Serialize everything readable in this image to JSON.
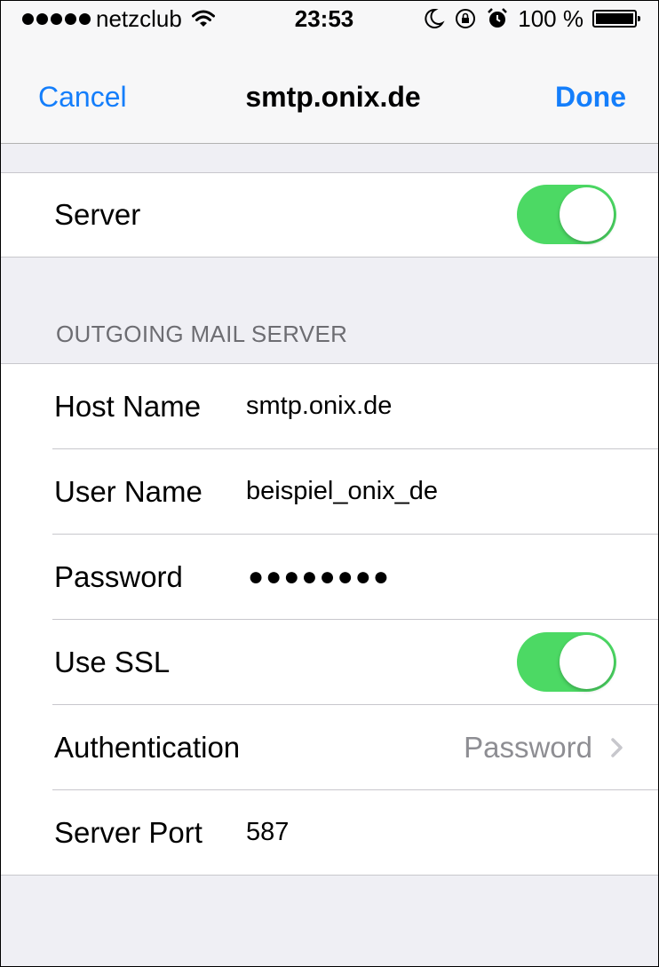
{
  "status_bar": {
    "carrier": "netzclub",
    "time": "23:53",
    "battery": "100 %"
  },
  "nav": {
    "cancel_label": "Cancel",
    "title": "smtp.onix.de",
    "done_label": "Done"
  },
  "server_group": {
    "label": "Server",
    "enabled": true
  },
  "outgoing": {
    "header": "OUTGOING MAIL SERVER",
    "host_name_label": "Host Name",
    "host_name_value": "smtp.onix.de",
    "user_name_label": "User Name",
    "user_name_value": "beispiel_onix_de",
    "password_label": "Password",
    "password_value": "●●●●●●●●",
    "use_ssl_label": "Use SSL",
    "use_ssl_enabled": true,
    "authentication_label": "Authentication",
    "authentication_value": "Password",
    "server_port_label": "Server Port",
    "server_port_value": "587"
  },
  "colors": {
    "accent": "#147efb",
    "toggle_on": "#4cd964",
    "background": "#efeff4",
    "secondary_text": "#8e8e93",
    "section_header": "#6d6d72"
  },
  "icons": [
    "signal-strength-icon",
    "wifi-icon",
    "moon-icon",
    "rotation-lock-icon",
    "alarm-icon",
    "battery-icon",
    "chevron-right-icon"
  ]
}
